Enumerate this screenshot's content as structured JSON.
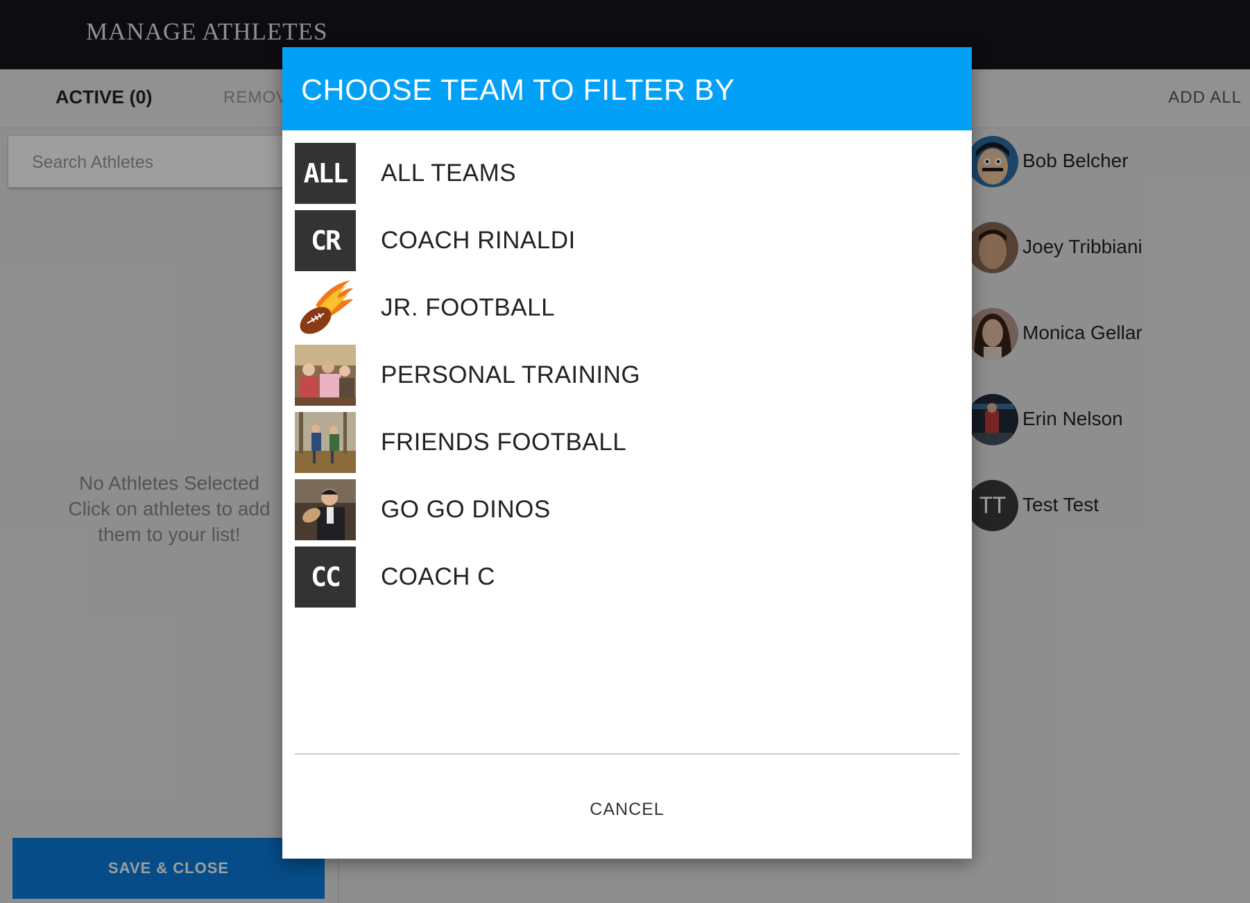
{
  "app": {
    "title": "MANAGE ATHLETES"
  },
  "tabs": {
    "active": "ACTIVE (0)",
    "removed": "REMOV",
    "add_all": "ADD ALL"
  },
  "search": {
    "placeholder": "Search Athletes"
  },
  "empty_state": {
    "line1": "No Athletes Selected",
    "line2": "Click on athletes to add",
    "line3": "them to your list!"
  },
  "save_button": "SAVE & CLOSE",
  "athletes": [
    {
      "name": "Bob Belcher",
      "avatar": "bob-belcher-photo"
    },
    {
      "name": "Joey Tribbiani",
      "avatar": "joey-tribbiani-photo"
    },
    {
      "name": "Monica Gellar",
      "avatar": "monica-gellar-photo"
    },
    {
      "name": "Erin Nelson",
      "avatar": "erin-nelson-photo"
    },
    {
      "name": "Test Test",
      "initials": "TT"
    }
  ],
  "dialog": {
    "title": "CHOOSE TEAM TO FILTER BY",
    "teams": [
      {
        "label": "ALL TEAMS",
        "initials": "ALL"
      },
      {
        "label": "COACH RINALDI",
        "initials": "CR"
      },
      {
        "label": "JR. FOOTBALL",
        "icon": "flaming-football-logo"
      },
      {
        "label": "PERSONAL TRAINING",
        "icon": "group-photo"
      },
      {
        "label": "FRIENDS FOOTBALL",
        "icon": "football-game-photo"
      },
      {
        "label": "GO GO DINOS",
        "icon": "man-with-football-photo"
      },
      {
        "label": "COACH C",
        "initials": "CC"
      }
    ],
    "cancel": "CANCEL"
  },
  "colors": {
    "header_blue": "#03a0f7",
    "save_blue": "#0a7bdc",
    "topbar": "#16161c"
  }
}
